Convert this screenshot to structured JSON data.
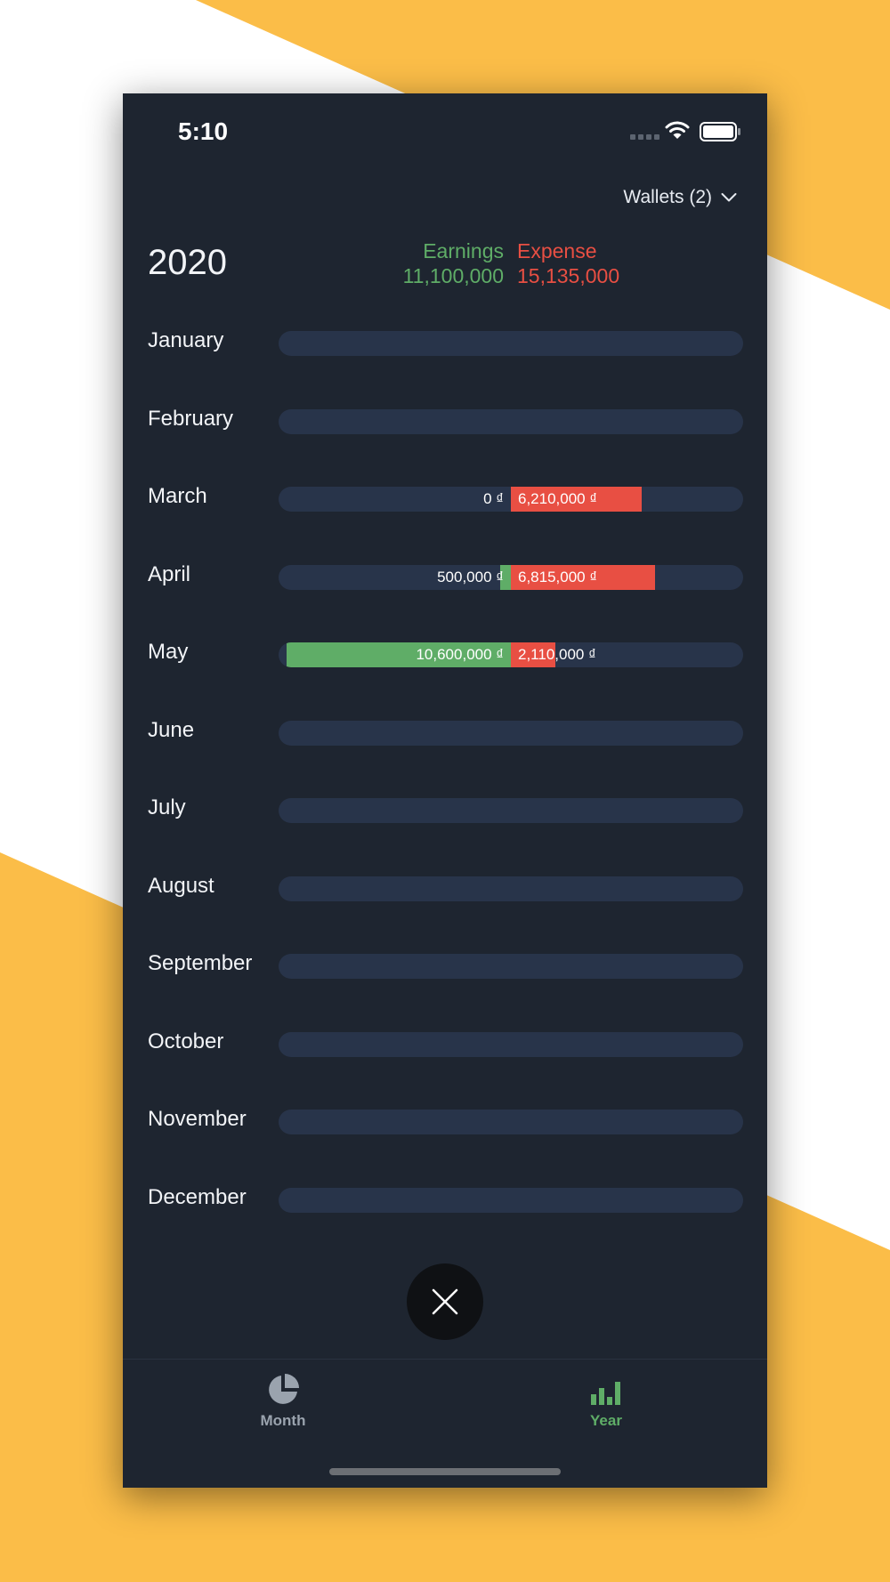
{
  "colors": {
    "accent_yellow": "#fbbd48",
    "panel": "#1e2530",
    "track": "#28344a",
    "earnings": "#5fad67",
    "expense": "#e84f43",
    "inactive_tab": "#9aa3ae"
  },
  "status_bar": {
    "time": "5:10"
  },
  "header": {
    "wallets_label": "Wallets (2)",
    "year": "2020",
    "earnings_label": "Earnings",
    "earnings_total": "11,100,000",
    "expense_label": "Expense",
    "expense_total": "15,135,000"
  },
  "months": [
    {
      "name": "January"
    },
    {
      "name": "February"
    },
    {
      "name": "March",
      "earnings": 0,
      "expense": 6210000,
      "earnings_label": "0 ₫",
      "expense_label": "6,210,000 ₫"
    },
    {
      "name": "April",
      "earnings": 500000,
      "expense": 6815000,
      "earnings_label": "500,000 ₫",
      "expense_label": "6,815,000 ₫"
    },
    {
      "name": "May",
      "earnings": 10600000,
      "expense": 2110000,
      "earnings_label": "10,600,000 ₫",
      "expense_label": "2,110,000 ₫"
    },
    {
      "name": "June"
    },
    {
      "name": "July"
    },
    {
      "name": "August"
    },
    {
      "name": "September"
    },
    {
      "name": "October"
    },
    {
      "name": "November"
    },
    {
      "name": "December"
    }
  ],
  "tabs": [
    {
      "label": "Month",
      "icon": "pie-chart-icon",
      "active": false
    },
    {
      "label": "Year",
      "icon": "bar-chart-icon",
      "active": true
    }
  ],
  "close_icon": "close-icon"
}
